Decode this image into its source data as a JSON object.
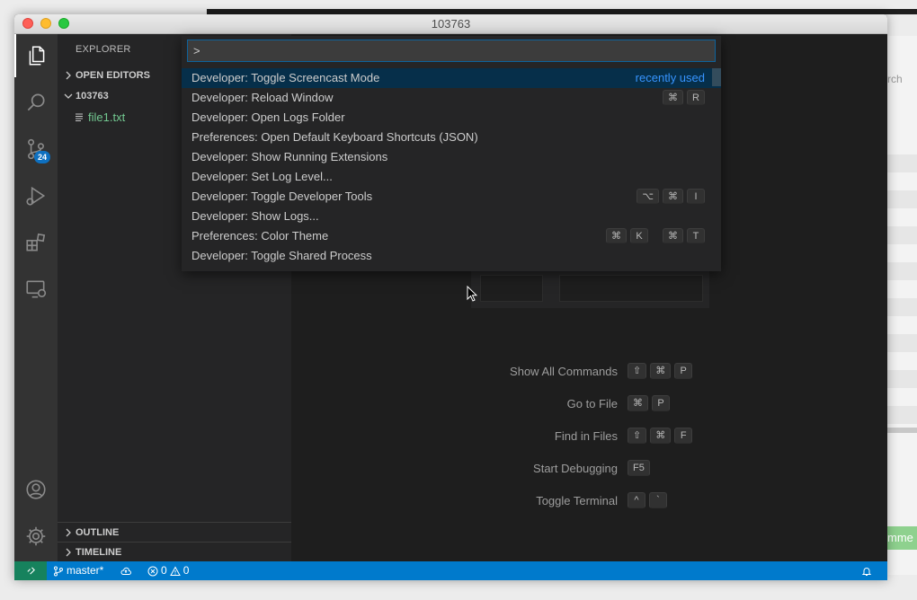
{
  "window": {
    "title": "103763"
  },
  "background_app": {
    "search_fragment": "rch",
    "button_fragment": "mme"
  },
  "activity_bar": {
    "items": [
      {
        "icon": "files-icon",
        "active": true
      },
      {
        "icon": "search-icon"
      },
      {
        "icon": "source-control-icon",
        "badge": "24"
      },
      {
        "icon": "run-debug-icon"
      },
      {
        "icon": "extensions-icon"
      },
      {
        "icon": "remote-explorer-icon"
      }
    ],
    "bottom": [
      {
        "icon": "account-icon"
      },
      {
        "icon": "gear-icon"
      }
    ]
  },
  "sidebar": {
    "title": "EXPLORER",
    "open_editors": "OPEN EDITORS",
    "folder": "103763",
    "files": [
      {
        "name": "file1.txt",
        "icon": "file-lines-icon",
        "color": "#73c991"
      }
    ],
    "outline": "OUTLINE",
    "timeline": "TIMELINE"
  },
  "command_palette": {
    "input_value": ">",
    "items": [
      {
        "label": "Developer: Toggle Screencast Mode",
        "tag": "recently used",
        "keys": []
      },
      {
        "label": "Developer: Reload Window",
        "keys": [
          [
            "⌘",
            "R"
          ]
        ]
      },
      {
        "label": "Developer: Open Logs Folder",
        "keys": []
      },
      {
        "label": "Preferences: Open Default Keyboard Shortcuts (JSON)",
        "keys": []
      },
      {
        "label": "Developer: Show Running Extensions",
        "keys": []
      },
      {
        "label": "Developer: Set Log Level...",
        "keys": []
      },
      {
        "label": "Developer: Toggle Developer Tools",
        "keys": [
          [
            "⌥",
            "⌘",
            "I"
          ]
        ]
      },
      {
        "label": "Developer: Show Logs...",
        "keys": []
      },
      {
        "label": "Preferences: Color Theme",
        "keys": [
          [
            "⌘",
            "K"
          ],
          [
            "⌘",
            "T"
          ]
        ]
      },
      {
        "label": "Developer: Toggle Shared Process",
        "keys": []
      }
    ]
  },
  "editor": {
    "shortcuts": [
      {
        "label": "Show All Commands",
        "keys": [
          "⇧",
          "⌘",
          "P"
        ]
      },
      {
        "label": "Go to File",
        "keys": [
          "⌘",
          "P"
        ]
      },
      {
        "label": "Find in Files",
        "keys": [
          "⇧",
          "⌘",
          "F"
        ]
      },
      {
        "label": "Start Debugging",
        "keys": [
          "F5"
        ]
      },
      {
        "label": "Toggle Terminal",
        "keys": [
          "^",
          "`"
        ]
      }
    ]
  },
  "status_bar": {
    "branch": "master*",
    "errors": "0",
    "warnings": "0",
    "colors": {
      "bar": "#007acc",
      "remote": "#16825d"
    }
  }
}
